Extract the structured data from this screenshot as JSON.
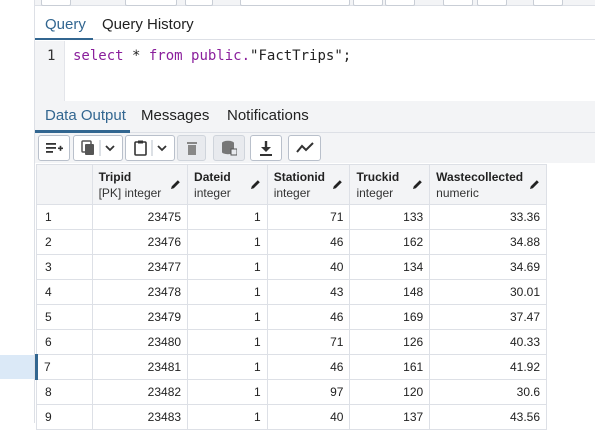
{
  "query_tabs": [
    {
      "label": "Query",
      "active": true
    },
    {
      "label": "Query History",
      "active": false
    }
  ],
  "editor": {
    "line_number": "1",
    "tokens": {
      "kw1": "select",
      "op": " * ",
      "kw2": "from",
      "schema": " public.",
      "table": "\"FactTrips\";"
    }
  },
  "output_tabs": [
    {
      "label": "Data Output",
      "active": true
    },
    {
      "label": "Messages",
      "active": false
    },
    {
      "label": "Notifications",
      "active": false
    }
  ],
  "toolbar": {
    "icons": [
      "add-row-icon",
      "copy-icon",
      "chevron-down-icon",
      "paste-icon",
      "chevron-down-icon",
      "delete-icon",
      "save-data-icon",
      "download-icon",
      "graph-icon"
    ]
  },
  "columns": [
    {
      "name": "Tripid",
      "type": "[PK] integer"
    },
    {
      "name": "Dateid",
      "type": "integer"
    },
    {
      "name": "Stationid",
      "type": "integer"
    },
    {
      "name": "Truckid",
      "type": "integer"
    },
    {
      "name": "Wastecollected",
      "type": "numeric"
    }
  ],
  "rows": [
    {
      "n": "1",
      "cells": [
        "23475",
        "1",
        "71",
        "133",
        "33.36"
      ]
    },
    {
      "n": "2",
      "cells": [
        "23476",
        "1",
        "46",
        "162",
        "34.88"
      ]
    },
    {
      "n": "3",
      "cells": [
        "23477",
        "1",
        "40",
        "134",
        "34.69"
      ]
    },
    {
      "n": "4",
      "cells": [
        "23478",
        "1",
        "43",
        "148",
        "30.01"
      ]
    },
    {
      "n": "5",
      "cells": [
        "23479",
        "1",
        "46",
        "169",
        "37.47"
      ]
    },
    {
      "n": "6",
      "cells": [
        "23480",
        "1",
        "71",
        "126",
        "40.33"
      ]
    },
    {
      "n": "7",
      "cells": [
        "23481",
        "1",
        "46",
        "161",
        "41.92"
      ]
    },
    {
      "n": "8",
      "cells": [
        "23482",
        "1",
        "97",
        "120",
        "30.6"
      ]
    },
    {
      "n": "9",
      "cells": [
        "23483",
        "1",
        "40",
        "137",
        "43.56"
      ]
    }
  ],
  "selected_row": "7",
  "colors": {
    "accent": "#326690",
    "keyword": "#8a1f9c",
    "header_bg": "#f3f4f6",
    "selection": "#dbe9f7"
  }
}
